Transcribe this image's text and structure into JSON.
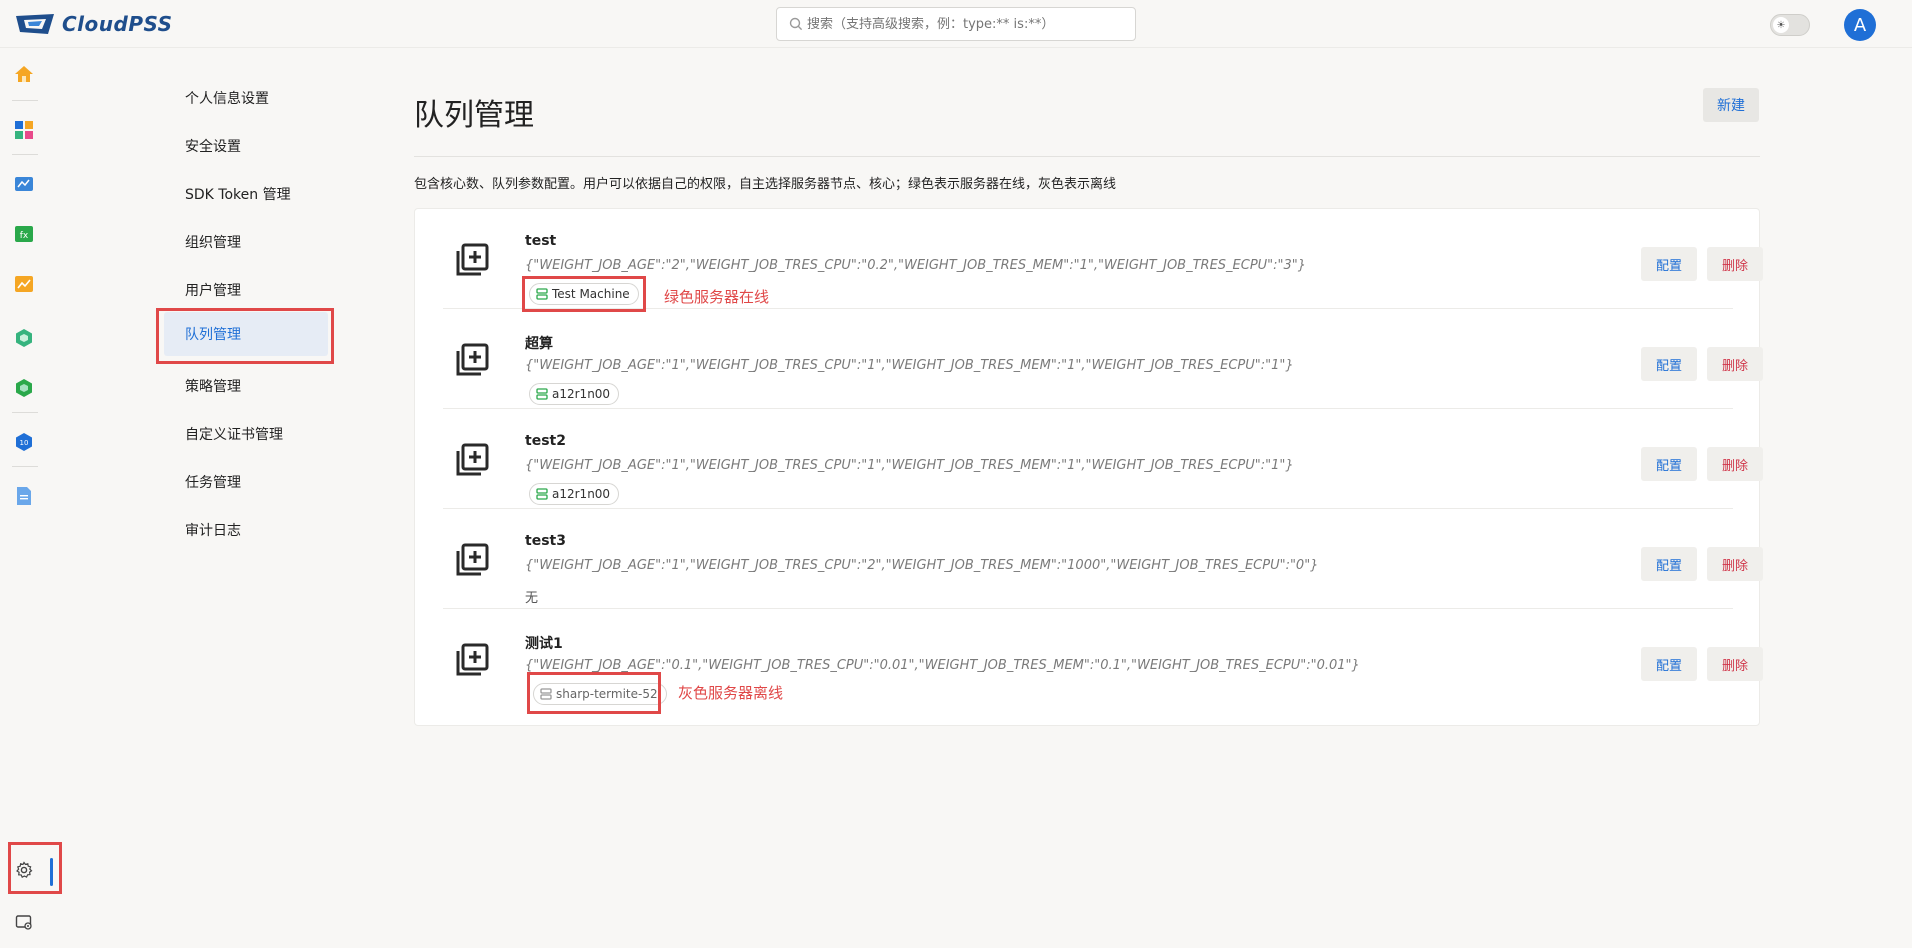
{
  "app": {
    "logo_text": "CloudPSS",
    "brand_color": "#1f4e8c",
    "accent": "#1f6fd6",
    "danger": "#d03448",
    "highlight": "#e04848",
    "avatar_letter": "A"
  },
  "search": {
    "placeholder": "搜索（支持高级搜索，例：type:** is:**）"
  },
  "rail": {
    "icons": [
      "home-icon",
      "apps-icon",
      "diagram-icon",
      "formula-icon",
      "chart-icon",
      "model-icon",
      "model-icon-2",
      "data-icon",
      "document-icon",
      "settings-icon",
      "admin-settings-icon"
    ]
  },
  "nav": {
    "items": [
      {
        "label": "个人信息设置"
      },
      {
        "label": "安全设置"
      },
      {
        "label": "SDK Token 管理"
      },
      {
        "label": "组织管理"
      },
      {
        "label": "用户管理"
      },
      {
        "label": "队列管理"
      },
      {
        "label": "策略管理"
      },
      {
        "label": "自定义证书管理"
      },
      {
        "label": "任务管理"
      },
      {
        "label": "审计日志"
      }
    ],
    "active_index": 5
  },
  "main": {
    "title": "队列管理",
    "new_button": "新建",
    "description": "包含核心数、队列参数配置。用户可以依据自己的权限，自主选择服务器节点、核心；绿色表示服务器在线，灰色表示离线",
    "config_label": "配置",
    "delete_label": "删除",
    "queues": [
      {
        "name": "test",
        "params": "{\"WEIGHT_JOB_AGE\":\"2\",\"WEIGHT_JOB_TRES_CPU\":\"0.2\",\"WEIGHT_JOB_TRES_MEM\":\"1\",\"WEIGHT_JOB_TRES_ECPU\":\"3\"}",
        "server": "Test Machine",
        "status": "online"
      },
      {
        "name": "超算",
        "params": "{\"WEIGHT_JOB_AGE\":\"1\",\"WEIGHT_JOB_TRES_CPU\":\"1\",\"WEIGHT_JOB_TRES_MEM\":\"1\",\"WEIGHT_JOB_TRES_ECPU\":\"1\"}",
        "server": "a12r1n00",
        "status": "online"
      },
      {
        "name": "test2",
        "params": "{\"WEIGHT_JOB_AGE\":\"1\",\"WEIGHT_JOB_TRES_CPU\":\"1\",\"WEIGHT_JOB_TRES_MEM\":\"1\",\"WEIGHT_JOB_TRES_ECPU\":\"1\"}",
        "server": "a12r1n00",
        "status": "online"
      },
      {
        "name": "test3",
        "params": "{\"WEIGHT_JOB_AGE\":\"1\",\"WEIGHT_JOB_TRES_CPU\":\"2\",\"WEIGHT_JOB_TRES_MEM\":\"1000\",\"WEIGHT_JOB_TRES_ECPU\":\"0\"}",
        "none_text": "无"
      },
      {
        "name": "测试1",
        "params": "{\"WEIGHT_JOB_AGE\":\"0.1\",\"WEIGHT_JOB_TRES_CPU\":\"0.01\",\"WEIGHT_JOB_TRES_MEM\":\"0.1\",\"WEIGHT_JOB_TRES_ECPU\":\"0.01\"}",
        "server": "sharp-termite-52",
        "status": "offline"
      }
    ]
  },
  "annotations": {
    "online": "绿色服务器在线",
    "offline": "灰色服务器离线"
  }
}
